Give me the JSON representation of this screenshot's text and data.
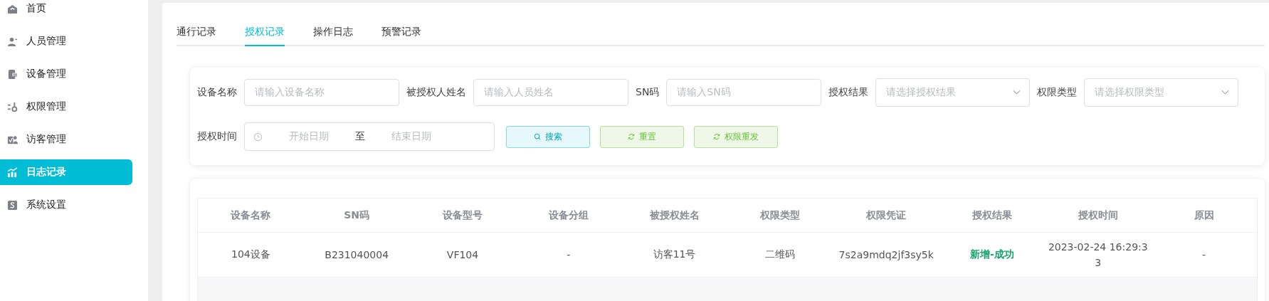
{
  "sidebar": {
    "items": [
      {
        "label": "首页",
        "selected": false
      },
      {
        "label": "人员管理",
        "selected": false
      },
      {
        "label": "设备管理",
        "selected": false
      },
      {
        "label": "权限管理",
        "selected": false
      },
      {
        "label": "访客管理",
        "selected": false
      },
      {
        "label": "日志记录",
        "selected": true
      },
      {
        "label": "系统设置",
        "selected": false
      }
    ]
  },
  "tabs": [
    {
      "label": "通行记录",
      "selected": false
    },
    {
      "label": "授权记录",
      "selected": true
    },
    {
      "label": "操作日志",
      "selected": false
    },
    {
      "label": "预警记录",
      "selected": false
    }
  ],
  "filters": [
    {
      "kind": "input",
      "label": "设备名称",
      "placeholder": "请输入设备名称"
    },
    {
      "kind": "input",
      "label": "被授权人姓名",
      "placeholder": "请输入人员姓名"
    },
    {
      "kind": "input",
      "label": "SN码",
      "placeholder": "请输入SN码"
    },
    {
      "kind": "select",
      "label": "授权结果",
      "placeholder": "请选择授权结果"
    },
    {
      "kind": "select",
      "label": "权限类型",
      "placeholder": "请选择权限类型"
    }
  ],
  "date_range": {
    "label": "授权时间",
    "start_placeholder": "开始日期",
    "separator": "至",
    "end_placeholder": "结束日期"
  },
  "buttons": [
    {
      "label": "搜索",
      "kind": "search"
    },
    {
      "label": "重置",
      "kind": "refresh"
    },
    {
      "label": "权限重发",
      "kind": "refresh"
    }
  ],
  "table": {
    "columns": [
      "设备名称",
      "SN码",
      "设备型号",
      "设备分组",
      "被授权姓名",
      "权限类型",
      "权限凭证",
      "授权结果",
      "授权时间",
      "原因"
    ],
    "rows": [
      {
        "cells": [
          "104设备",
          "B231040004",
          "VF104",
          "-",
          "访客11号",
          "二维码",
          "7s2a9mdq2jf3sy5k",
          "新增-成功",
          "2023-02-24 16:29:33",
          "-"
        ]
      }
    ]
  }
}
